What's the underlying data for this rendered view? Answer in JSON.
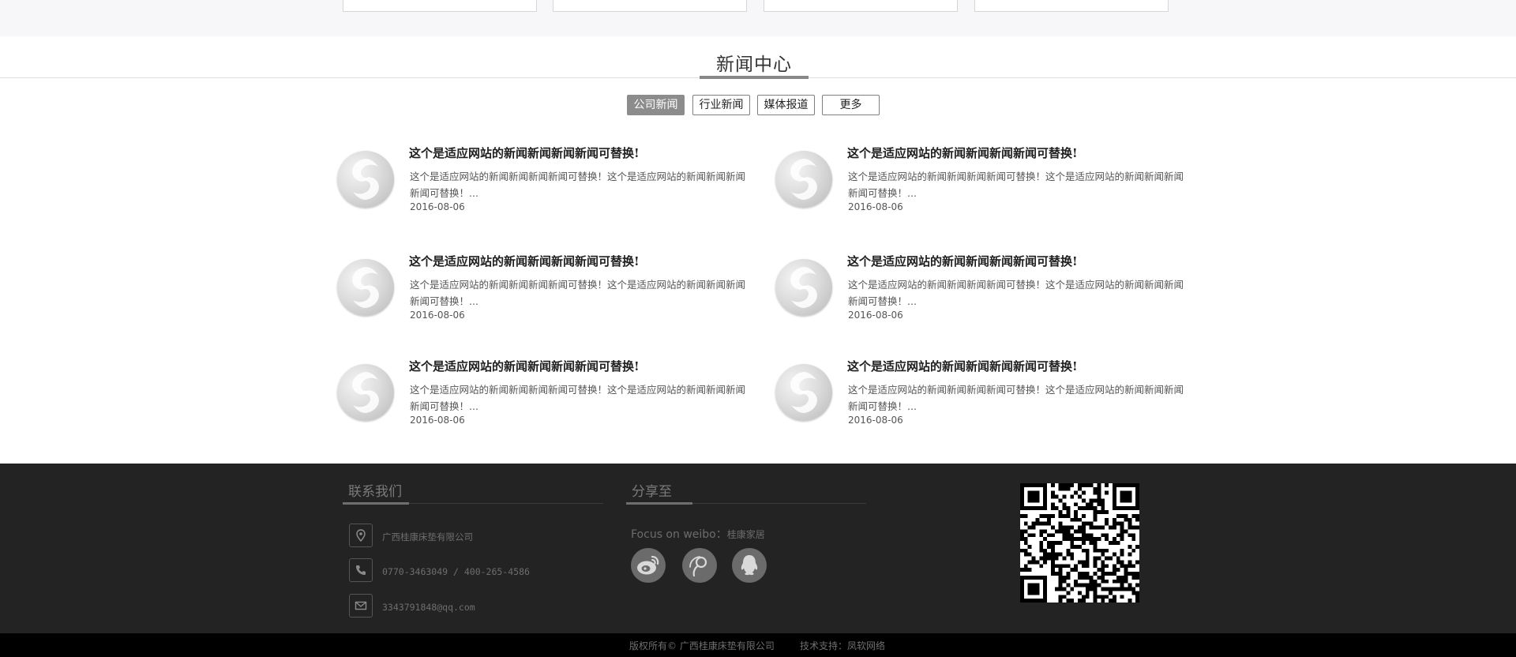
{
  "news_section": {
    "title": "新闻中心",
    "tabs": [
      {
        "label": "公司新闻",
        "active": true
      },
      {
        "label": "行业新闻",
        "active": false
      },
      {
        "label": "媒体报道",
        "active": false
      },
      {
        "label": "更多",
        "active": false
      }
    ],
    "items": [
      {
        "title": "这个是适应网站的新闻新闻新闻新闻可替换!",
        "summary": "这个是适应网站的新闻新闻新闻新闻可替换！这个是适应网站的新闻新闻新闻新闻可替换！...",
        "date": "2016-08-06"
      },
      {
        "title": "这个是适应网站的新闻新闻新闻新闻可替换!",
        "summary": "这个是适应网站的新闻新闻新闻新闻可替换！这个是适应网站的新闻新闻新闻新闻可替换！...",
        "date": "2016-08-06"
      },
      {
        "title": "这个是适应网站的新闻新闻新闻新闻可替换!",
        "summary": "这个是适应网站的新闻新闻新闻新闻可替换！这个是适应网站的新闻新闻新闻新闻可替换！...",
        "date": "2016-08-06"
      },
      {
        "title": "这个是适应网站的新闻新闻新闻新闻可替换!",
        "summary": "这个是适应网站的新闻新闻新闻新闻可替换！这个是适应网站的新闻新闻新闻新闻可替换！...",
        "date": "2016-08-06"
      },
      {
        "title": "这个是适应网站的新闻新闻新闻新闻可替换!",
        "summary": "这个是适应网站的新闻新闻新闻新闻可替换！这个是适应网站的新闻新闻新闻新闻可替换！...",
        "date": "2016-08-06"
      },
      {
        "title": "这个是适应网站的新闻新闻新闻新闻可替换!",
        "summary": "这个是适应网站的新闻新闻新闻新闻可替换！这个是适应网站的新闻新闻新闻新闻可替换！...",
        "date": "2016-08-06"
      }
    ]
  },
  "footer": {
    "contact": {
      "heading": "联系我们",
      "company": "广西桂康床垫有限公司",
      "phone": "0770-3463049 / 400-265-4586",
      "email": "3343791848@qq.com"
    },
    "share": {
      "heading": "分享至",
      "focus_label": "Focus on weibo：",
      "focus_value": "桂康家居",
      "buttons": [
        "weibo-icon",
        "tencent-weibo-icon",
        "qq-icon"
      ]
    },
    "copyright": "版权所有© 广西桂康床垫有限公司",
    "support": "技术支持：凤软网络"
  },
  "colors": {
    "footer_bg": "#232323",
    "copyright_bg": "#000000",
    "active_tab": "#8c8c8c"
  }
}
